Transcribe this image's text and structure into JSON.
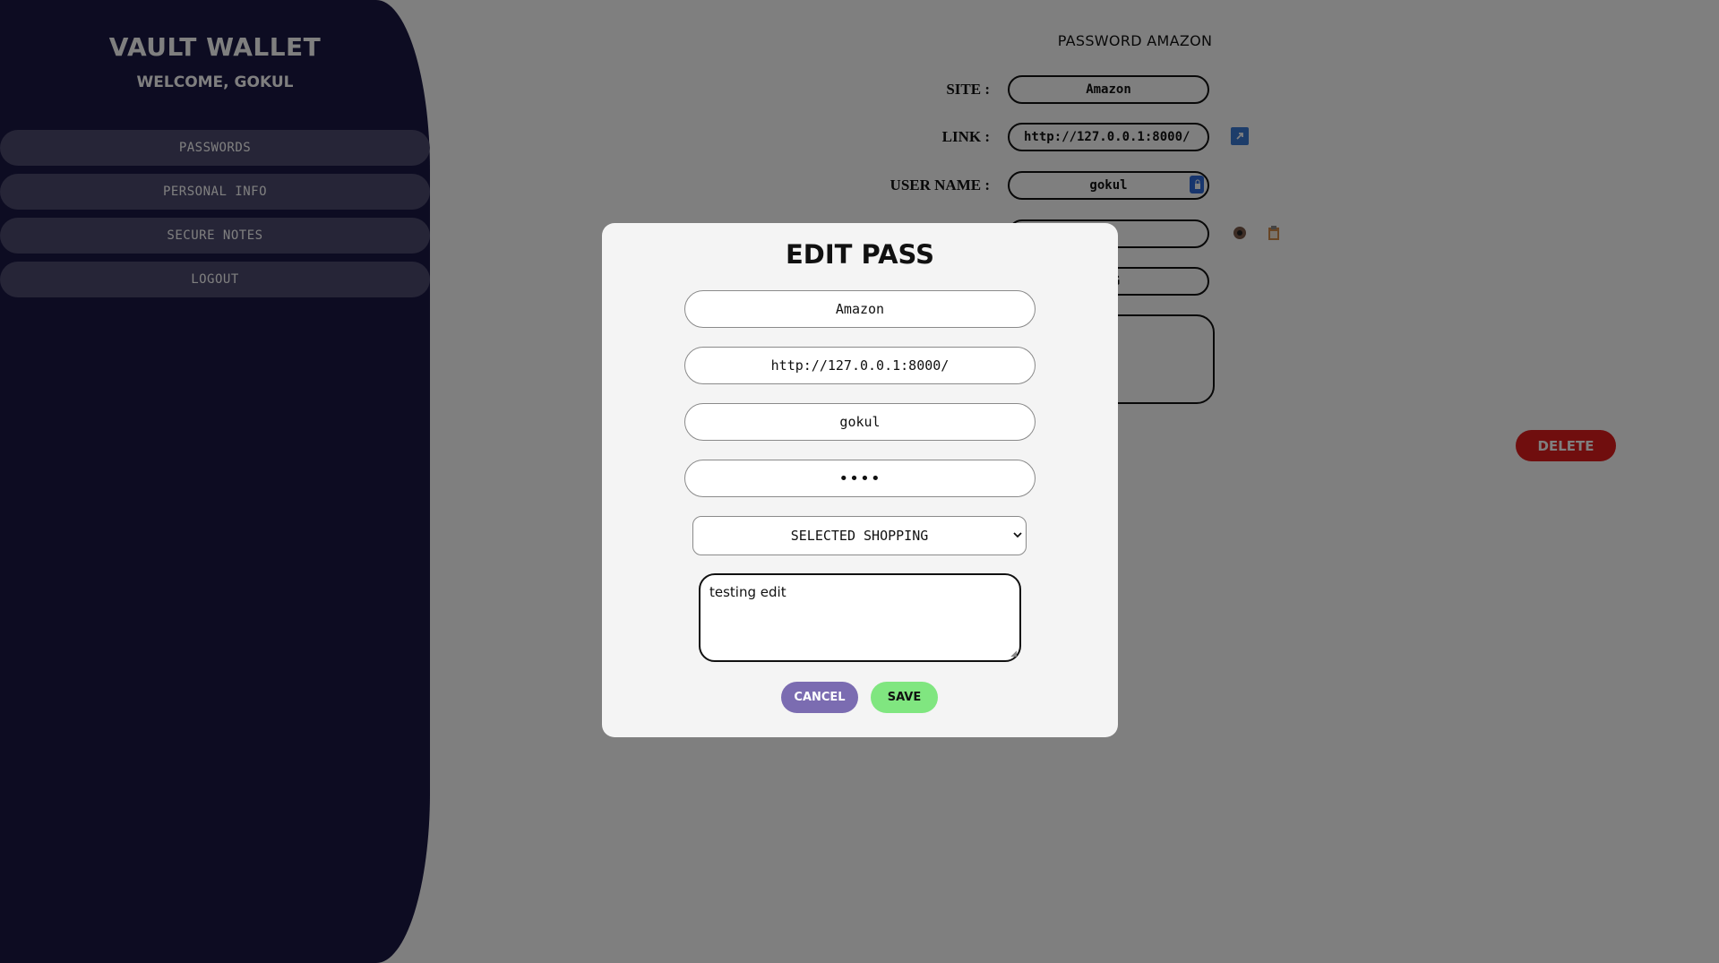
{
  "sidebar": {
    "brand": "VAULT WALLET",
    "welcome": "WELCOME, GOKUL",
    "items": [
      {
        "label": "PASSWORDS"
      },
      {
        "label": "PERSONAL INFO"
      },
      {
        "label": "SECURE NOTES"
      },
      {
        "label": "LOGOUT"
      }
    ]
  },
  "detail": {
    "title": "PASSWORD AMAZON",
    "site_label": "SITE :",
    "site_value": "Amazon",
    "link_label": "LINK :",
    "link_value": "http://127.0.0.1:8000/",
    "username_label": "USER NAME :",
    "username_value": "gokul",
    "password_value": "●",
    "category_value": "ING",
    "delete_label": "DELETE"
  },
  "modal": {
    "title": "EDIT PASS",
    "site": "Amazon",
    "link": "http://127.0.0.1:8000/",
    "username": "gokul",
    "password_masked": "••••",
    "category": "SELECTED SHOPPING",
    "notes": "testing edit",
    "cancel_label": "CANCEL",
    "save_label": "SAVE"
  },
  "colors": {
    "sidebar_bg": "#1b1945",
    "nav_item_bg": "#4d4a6e",
    "cancel_bg": "#7b6cb1",
    "save_bg": "#80e680",
    "delete_bg": "#e11d1d"
  }
}
